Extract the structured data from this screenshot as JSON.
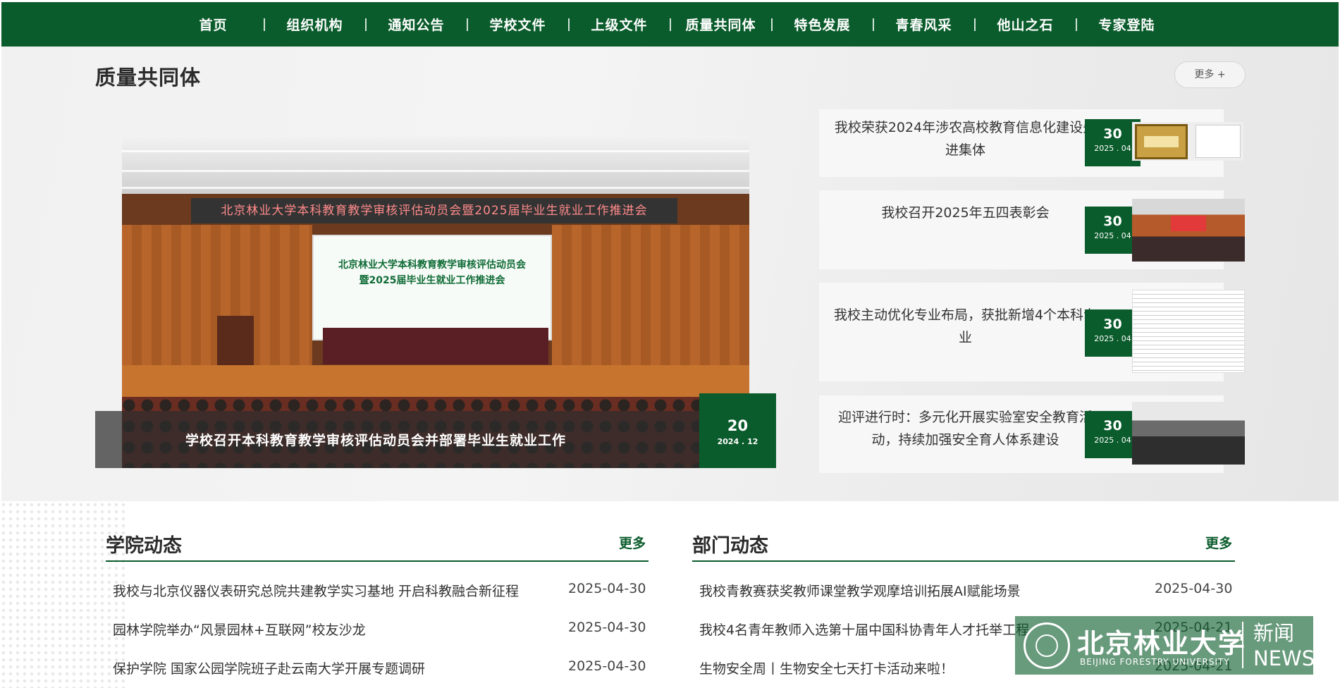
{
  "nav": [
    "首页",
    "组织机构",
    "通知公告",
    "学校文件",
    "上级文件",
    "质量共同体",
    "特色发展",
    "青春风采",
    "他山之石",
    "专家登陆"
  ],
  "section": {
    "title": "质量共同体",
    "more": "更多 +"
  },
  "feature": {
    "banner": "北京林业大学本科教育教学审核评估动员会暨2025届毕业生就业工作推进会",
    "screen_line1": "北京林业大学本科教育教学审核评估动员会",
    "screen_line2": "暨2025届毕业生就业工作推进会",
    "caption": "学校召开本科教育教学审核评估动员会并部署毕业生就业工作",
    "day": "20",
    "ym": "2024 . 12"
  },
  "side_news": [
    {
      "title": "我校荣获2024年涉农高校教育信息化建设先进集体",
      "day": "30",
      "ym": "2025 . 04",
      "thumb": "certificate"
    },
    {
      "title": "我校召开2025年五四表彰会",
      "day": "30",
      "ym": "2025 . 04",
      "thumb": "auditorium"
    },
    {
      "title": "我校主动优化专业布局，获批新增4个本科专业",
      "day": "30",
      "ym": "2025 . 04",
      "thumb": "document-table"
    },
    {
      "title": "迎评进行时：多元化开展实验室安全教育活动，持续加强安全育人体系建设",
      "day": "30",
      "ym": "2025 . 04",
      "thumb": "lecture-hall"
    }
  ],
  "college": {
    "title": "学院动态",
    "more": "更多",
    "items": [
      {
        "title": "我校与北京仪器仪表研究总院共建教学实习基地 开启科教融合新征程",
        "date": "2025-04-30"
      },
      {
        "title": "园林学院举办“风景园林+互联网”校友沙龙",
        "date": "2025-04-30"
      },
      {
        "title": "保护学院 国家公园学院班子赴云南大学开展专题调研",
        "date": "2025-04-30"
      }
    ]
  },
  "dept": {
    "title": "部门动态",
    "more": "更多",
    "items": [
      {
        "title": "我校青教赛获奖教师课堂教学观摩培训拓展AI赋能场景",
        "date": "2025-04-30"
      },
      {
        "title": "我校4名青年教师入选第十届中国科协青年人才托举工程",
        "date": "2025-04-21"
      },
      {
        "title": "生物安全周丨生物安全七天打卡活动来啦！",
        "date": "2025-04-21"
      }
    ]
  },
  "logo": {
    "cn": "北京林业大学",
    "en": "BEIJING FORESTRY UNIVERSITY",
    "news_cn": "新闻",
    "news_en": "NEWS"
  },
  "colors": {
    "primary_green": "#0b5c2c",
    "background_gray": "#f2f2f2"
  }
}
